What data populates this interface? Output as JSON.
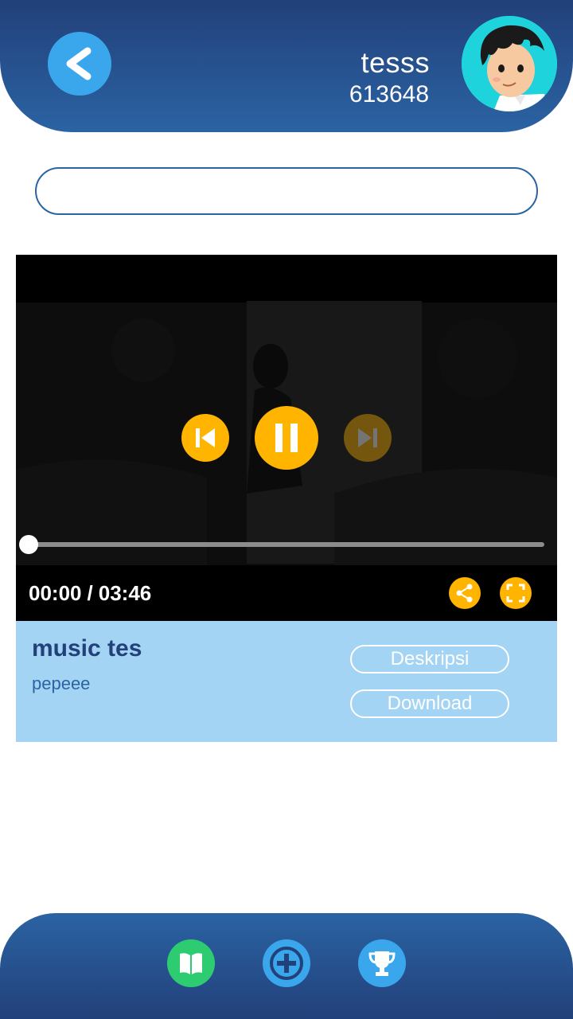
{
  "header": {
    "username": "tesss",
    "user_id": "613648",
    "back_icon": "back-arrow-icon",
    "avatar_icon": "cartoon-boy-avatar"
  },
  "search": {
    "value": "",
    "placeholder": ""
  },
  "player": {
    "current_time": "00:00",
    "separator": "/",
    "duration": "03:46",
    "progress": 0,
    "controls": {
      "previous_icon": "skip-previous-icon",
      "pause_icon": "pause-icon",
      "next_icon": "skip-next-icon",
      "share_icon": "share-icon",
      "fullscreen_icon": "fullscreen-icon"
    }
  },
  "track": {
    "title": "music tes",
    "artist": "pepeee",
    "description_label": "Deskripsi",
    "download_label": "Download"
  },
  "bottom_nav": {
    "items": [
      {
        "icon": "book-icon",
        "color": "#2ecc71"
      },
      {
        "icon": "add-circle-icon",
        "color": "#3aa6ec"
      },
      {
        "icon": "trophy-icon",
        "color": "#3aa6ec"
      }
    ]
  },
  "colors": {
    "header_dark": "#22407a",
    "header_light": "#2b63a3",
    "accent_orange": "#ffb400",
    "info_panel": "#a4d4f4",
    "back_button": "#3aa6ec"
  }
}
